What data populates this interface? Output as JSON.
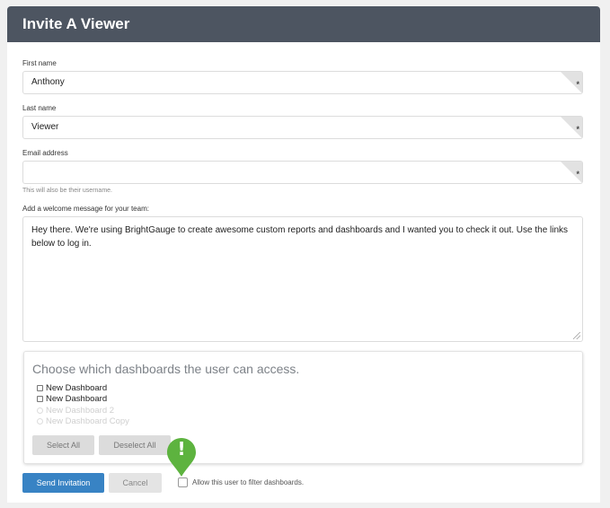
{
  "modal": {
    "title": "Invite A Viewer"
  },
  "form": {
    "first_name": {
      "label": "First name",
      "value": "Anthony",
      "required_mark": "*"
    },
    "last_name": {
      "label": "Last name",
      "value": "Viewer",
      "required_mark": "*"
    },
    "email": {
      "label": "Email address",
      "value": "",
      "required_mark": "*",
      "hint": "This will also be their username."
    },
    "welcome": {
      "label": "Add a welcome message for your team:",
      "value": "Hey there. We're using BrightGauge to create awesome custom reports and dashboards and I wanted you to check it out. Use the links below to log in."
    }
  },
  "dashboards": {
    "title": "Choose which dashboards the user can access.",
    "items": [
      {
        "label": "New Dashboard",
        "control": "checkbox",
        "enabled": true,
        "checked": false
      },
      {
        "label": "New Dashboard",
        "control": "checkbox",
        "enabled": true,
        "checked": false
      },
      {
        "label": "New Dashboard 2",
        "control": "radio",
        "enabled": false,
        "checked": false
      },
      {
        "label": "New Dashboard Copy",
        "control": "radio",
        "enabled": false,
        "checked": false
      }
    ],
    "select_all_label": "Select All",
    "deselect_all_label": "Deselect All"
  },
  "footer": {
    "send_label": "Send Invitation",
    "cancel_label": "Cancel",
    "filter_label": "Allow this user to filter dashboards.",
    "filter_checked": false
  },
  "alert": {
    "icon": "exclamation-pin-icon",
    "glyph": "!",
    "color": "#5db33f"
  },
  "colors": {
    "header_bg": "#4d5561",
    "primary": "#3883c4"
  }
}
